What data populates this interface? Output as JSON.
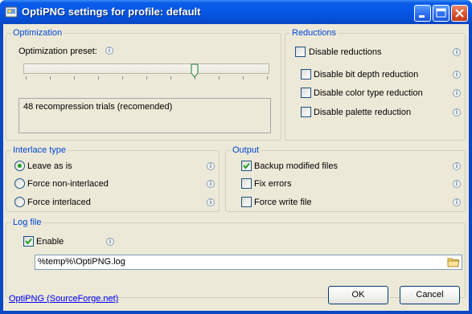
{
  "window": {
    "title": "OptiPNG settings for profile: default"
  },
  "optimization": {
    "group_title": "Optimization",
    "preset_label": "Optimization preset:",
    "slider_position": 0.7,
    "slider_ticks": 11,
    "description": "48 recompression trials (recomended)"
  },
  "reductions": {
    "group_title": "Reductions",
    "disable_reductions": {
      "label": "Disable reductions",
      "checked": false
    },
    "disable_bit_depth": {
      "label": "Disable bit depth reduction",
      "checked": false
    },
    "disable_color_type": {
      "label": "Disable color type reduction",
      "checked": false
    },
    "disable_palette": {
      "label": "Disable palette reduction",
      "checked": false
    }
  },
  "interlace": {
    "group_title": "Interlace type",
    "options": [
      {
        "label": "Leave as is",
        "selected": true
      },
      {
        "label": "Force non-interlaced",
        "selected": false
      },
      {
        "label": "Force interlaced",
        "selected": false
      }
    ]
  },
  "output": {
    "group_title": "Output",
    "backup": {
      "label": "Backup modified files",
      "checked": true
    },
    "fix_errors": {
      "label": "Fix errors",
      "checked": false
    },
    "force_write": {
      "label": "Force write file",
      "checked": false
    }
  },
  "log_file": {
    "group_title": "Log file",
    "enable": {
      "label": "Enable",
      "checked": true
    },
    "path": "%temp%\\OptiPNG.log"
  },
  "footer": {
    "link": "OptiPNG (SourceForge.net)",
    "ok": "OK",
    "cancel": "Cancel"
  },
  "colors": {
    "accent": "#0046d5",
    "titlebar": "#0657e6",
    "check": "#21a121"
  }
}
